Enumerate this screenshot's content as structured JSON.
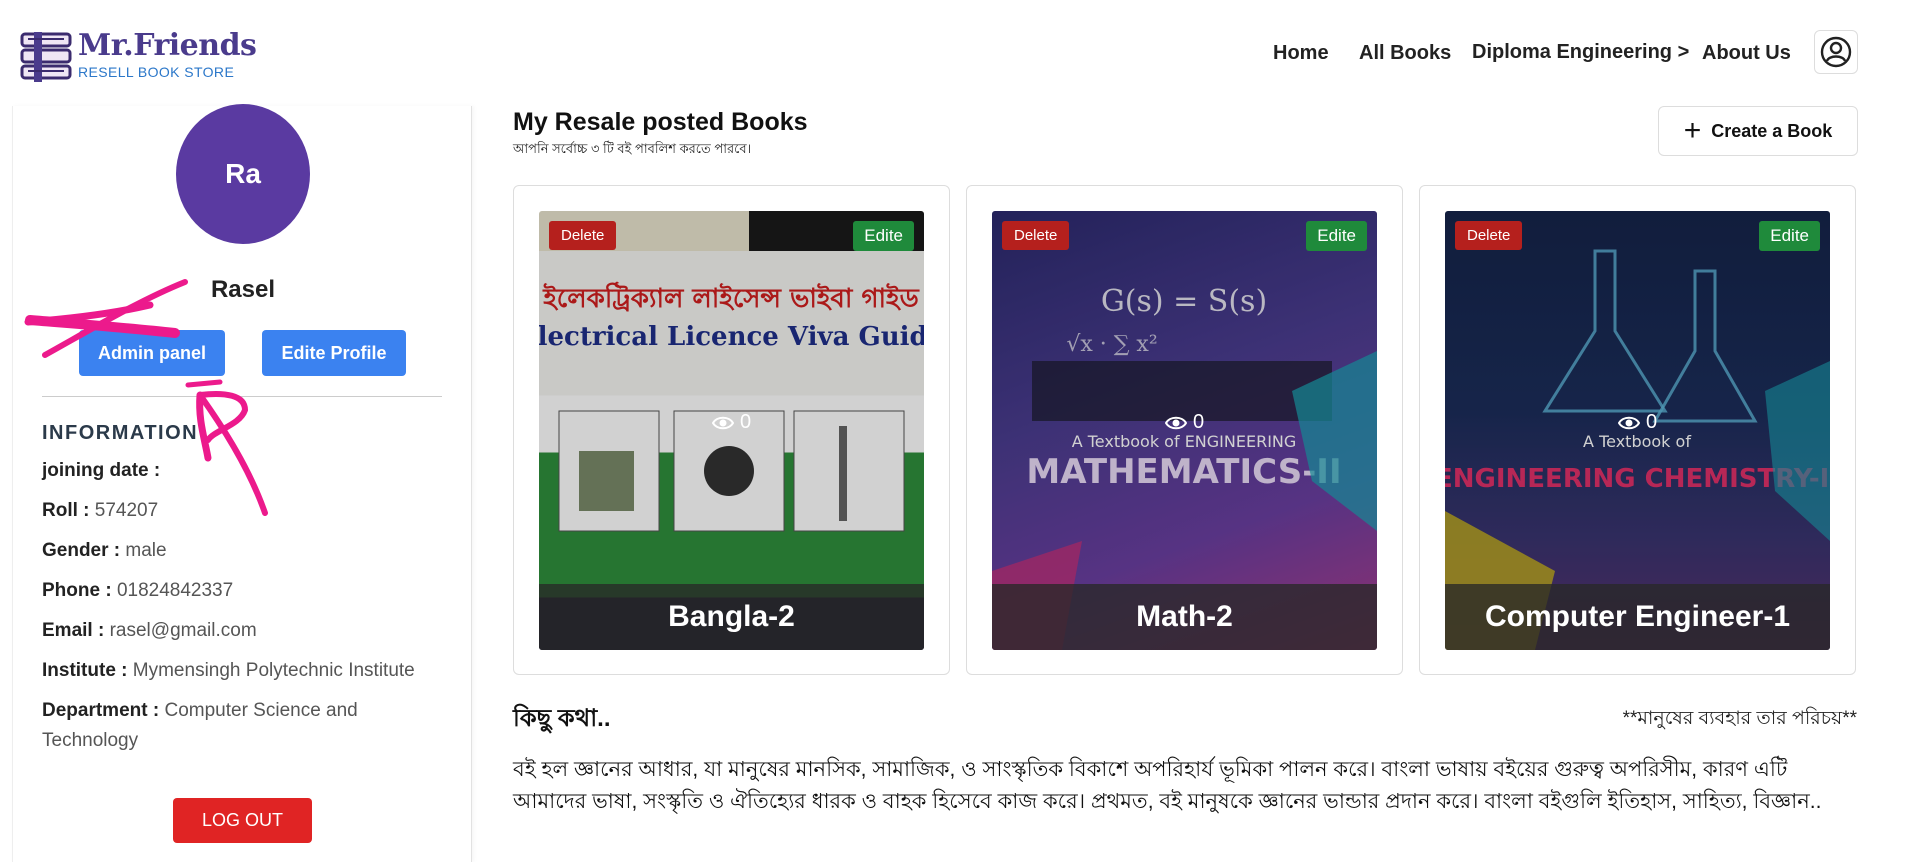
{
  "brand": {
    "title": "Mr.Friends",
    "subtitle": "RESELL BOOK STORE"
  },
  "nav": {
    "home": "Home",
    "all_books": "All Books",
    "diploma": "Diploma Engineering >",
    "about": "About Us"
  },
  "profile": {
    "avatar_initials": "Ra",
    "name": "Rasel",
    "admin_button": "Admin panel",
    "edit_button": "Edite Profile",
    "info_title": "INFORMATION",
    "fields": [
      {
        "label": "joining date :",
        "value": ""
      },
      {
        "label": "Roll :",
        "value": "574207"
      },
      {
        "label": "Gender :",
        "value": "male"
      },
      {
        "label": "Phone :",
        "value": "01824842337"
      },
      {
        "label": "Email :",
        "value": "rasel@gmail.com"
      },
      {
        "label": "Institute :",
        "value": "Mymensingh Polytechnic Institute"
      },
      {
        "label": "Department :",
        "value": "Computer Science and Technology"
      }
    ],
    "logout_button": "LOG OUT"
  },
  "main": {
    "title": "My Resale posted Books",
    "subtitle": "আপনি সর্বোচ্চ ৩ টি বই পাবলিশ করতে পারবে।",
    "create_button": "Create a Book",
    "books": [
      {
        "title": "Bangla-2",
        "views": "0",
        "delete_label": "Delete",
        "edit_label": "Edite",
        "cover_heading": "ইলেকট্রিক্যাল লাইসেন্স ভাইবা গাইড",
        "cover_subheading": "Electrical Licence Viva Guide"
      },
      {
        "title": "Math-2",
        "views": "0",
        "delete_label": "Delete",
        "edit_label": "Edite",
        "cover_heading": "MATHEMATICS-II",
        "cover_subheading": "A Textbook of ENGINEERING"
      },
      {
        "title": "Computer Engineer-1",
        "views": "0",
        "delete_label": "Delete",
        "edit_label": "Edite",
        "cover_heading": "ENGINEERING CHEMISTRY-II",
        "cover_subheading": "A Textbook of"
      }
    ]
  },
  "about": {
    "title": "কিছু কথা..",
    "motto": "**মানুষের ব্যবহার  তার পরিচয়**",
    "text": "বই হল জ্ঞানের আধার, যা মানুষের মানসিক, সামাজিক, ও সাংস্কৃতিক বিকাশে অপরিহার্য ভূমিকা পালন করে। বাংলা ভাষায় বইয়ের গুরুত্ব অপরিসীম, কারণ এটি আমাদের ভাষা, সংস্কৃতি ও ঐতিহ্যের ধারক ও বাহক হিসেবে কাজ করে। প্রথমত, বই মানুষকে জ্ঞানের ভান্ডার প্রদান করে। বাংলা বইগুলি ইতিহাস, সাহিত্য, বিজ্ঞান.."
  },
  "colors": {
    "brand": "#4a3b8c",
    "accent_blue": "#3b82f0",
    "danger": "#e02424",
    "success": "#1f8a3b",
    "annotation": "#ec1a8c"
  }
}
